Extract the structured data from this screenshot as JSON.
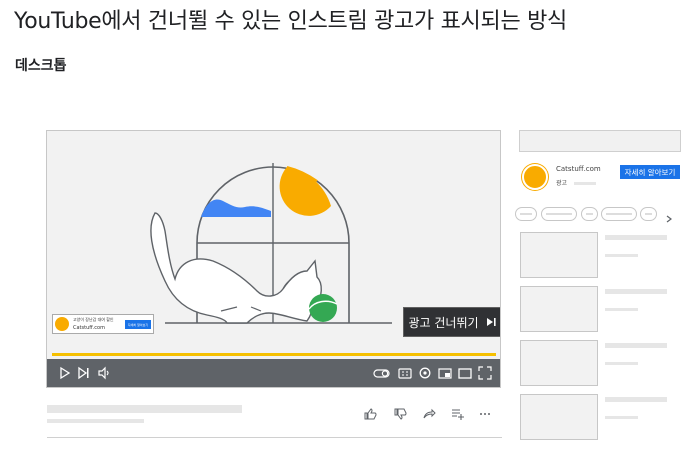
{
  "page": {
    "title": "YouTube에서 건너뛸 수 있는 인스트림 광고가 표시되는 방식",
    "subtitle": "데스크톱"
  },
  "player": {
    "skip_button_label": "광고 건너뛰기",
    "overlay": {
      "headline": "고양이 장난감 대여 할인",
      "domain": "Catstuff.com",
      "cta": "자세히 알아보기"
    },
    "controls": [
      "play-icon",
      "next-icon",
      "volume-icon",
      "autoplay-icon",
      "captions-icon",
      "settings-icon",
      "miniplayer-icon",
      "theater-icon",
      "fullscreen-icon"
    ],
    "progress_color": "#f6c000"
  },
  "actions": [
    "like-icon",
    "dislike-icon",
    "share-icon",
    "add-to-playlist-icon",
    "more-icon"
  ],
  "sidebar": {
    "ad": {
      "domain": "Catstuff.com",
      "label": "광고",
      "cta": "자세히 알아보기"
    }
  },
  "colors": {
    "accent_blue": "#1a73e8",
    "brand_yellow": "#f9ab00",
    "ball_green": "#34a853",
    "sky_blue": "#4285f4",
    "controls_gray": "#5f6368"
  }
}
